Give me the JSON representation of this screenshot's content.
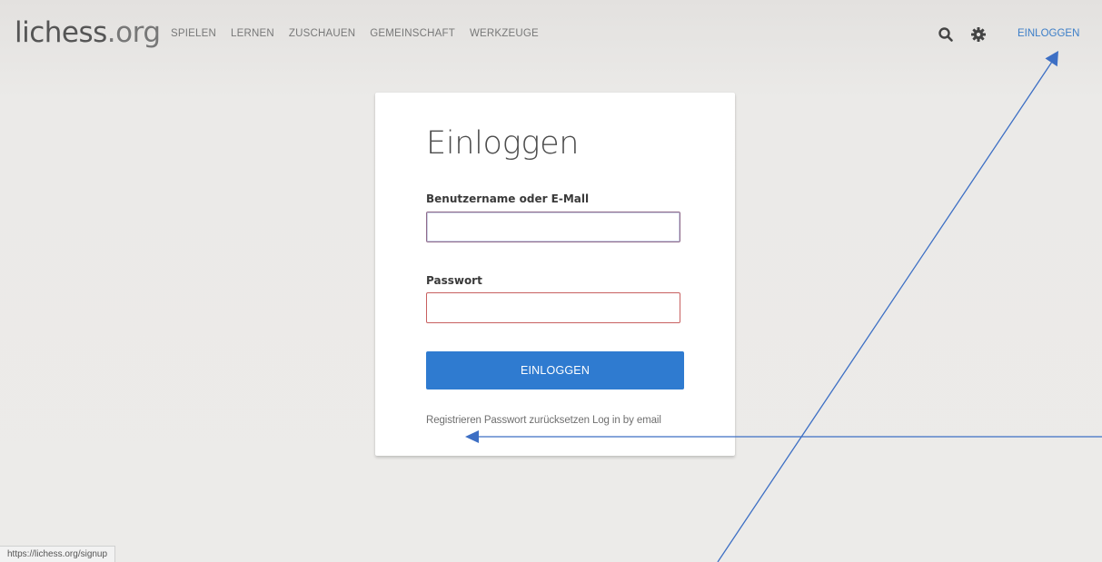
{
  "header": {
    "logo_main": "lichess",
    "logo_tld": ".org",
    "nav": [
      {
        "label": "SPIELEN"
      },
      {
        "label": "LERNEN"
      },
      {
        "label": "ZUSCHAUEN"
      },
      {
        "label": "GEMEINSCHAFT"
      },
      {
        "label": "WERKZEUGE"
      }
    ],
    "icons": {
      "search": "search-icon",
      "settings": "gear-icon"
    },
    "signin_label": "EINLOGGEN"
  },
  "login": {
    "title": "Einloggen",
    "username_label": "Benutzername oder E-Mall",
    "username_value": "",
    "password_label": "Passwort",
    "password_value": "",
    "submit_label": "EINLOGGEN",
    "links": [
      {
        "label": "Registrieren"
      },
      {
        "label": "Passwort zurücksetzen"
      },
      {
        "label": "Log in by email"
      }
    ]
  },
  "statusbar": {
    "url": "https://lichess.org/signup"
  },
  "colors": {
    "accent": "#2f7bd0",
    "link": "#3c7ec8",
    "annotation": "#3d6fc4",
    "error_border": "#c86060"
  }
}
